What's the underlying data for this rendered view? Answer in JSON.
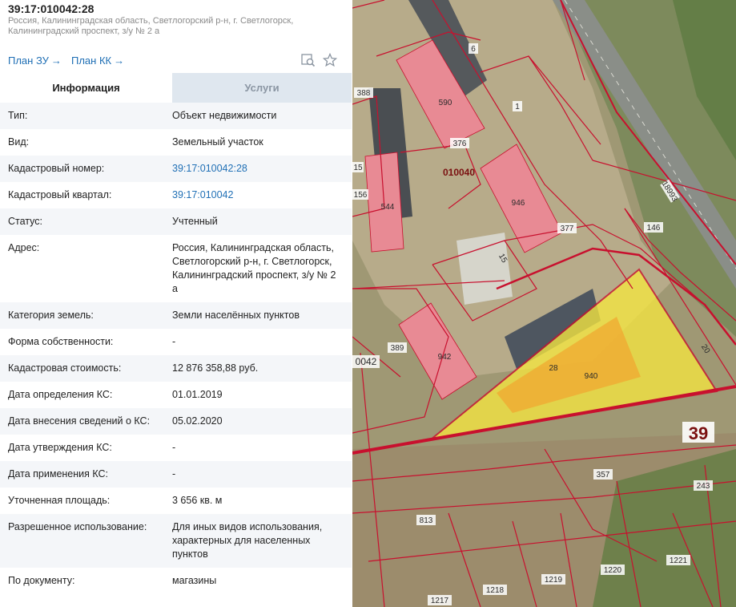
{
  "header": {
    "title": "39:17:010042:28",
    "address_line1": "Россия, Калининградская область, Светлогорский р-н, г. Светлогорск,",
    "address_line2": "Калининградский проспект, з/у № 2 а"
  },
  "links": {
    "plan_zu": "План ЗУ",
    "plan_kk": "План КК",
    "arrow": "→"
  },
  "icons": {
    "search_map": "search-map-icon",
    "favorite": "star-icon"
  },
  "tabs": {
    "info": "Информация",
    "services": "Услуги"
  },
  "info": [
    {
      "label": "Тип:",
      "value": "Объект недвижимости"
    },
    {
      "label": "Вид:",
      "value": "Земельный участок"
    },
    {
      "label": "Кадастровый номер:",
      "value": "39:17:010042:28",
      "link": true
    },
    {
      "label": "Кадастровый квартал:",
      "value": "39:17:010042",
      "link": true
    },
    {
      "label": "Статус:",
      "value": "Учтенный"
    },
    {
      "label": "Адрес:",
      "value": "Россия, Калининградская область, Светлогорский р-н, г. Светлогорск, Калининградский проспект, з/у № 2 а"
    },
    {
      "label": "Категория земель:",
      "value": "Земли населённых пунктов"
    },
    {
      "label": "Форма собственности:",
      "value": "-"
    },
    {
      "label": "Кадастровая стоимость:",
      "value": "12 876 358,88 руб."
    },
    {
      "label": "Дата определения КС:",
      "value": "01.01.2019"
    },
    {
      "label": "Дата внесения сведений о КС:",
      "value": "05.02.2020"
    },
    {
      "label": "Дата утверждения КС:",
      "value": "-"
    },
    {
      "label": "Дата применения КС:",
      "value": "-"
    },
    {
      "label": "Уточненная площадь:",
      "value": "3 656 кв. м"
    },
    {
      "label": "Разрешенное использование:",
      "value": "Для иных видов использования, характерных для населенных пунктов"
    },
    {
      "label": "По документу:",
      "value": "магазины"
    }
  ],
  "map": {
    "parcel_labels": [
      "6",
      "388",
      "590",
      "1",
      "376",
      "010040",
      "15",
      "156",
      "544",
      "946",
      "18993",
      "146",
      "377",
      "15",
      "389",
      "942",
      "0042",
      "28",
      "940",
      "20",
      "39",
      "357",
      "243",
      "813",
      "1221",
      "1220",
      "1219",
      "1218",
      "1217"
    ],
    "colors": {
      "boundary": "#c8102e",
      "selected_fill": "#f5e640",
      "selected_inner": "#f0a830",
      "building": "#e88a94"
    }
  }
}
